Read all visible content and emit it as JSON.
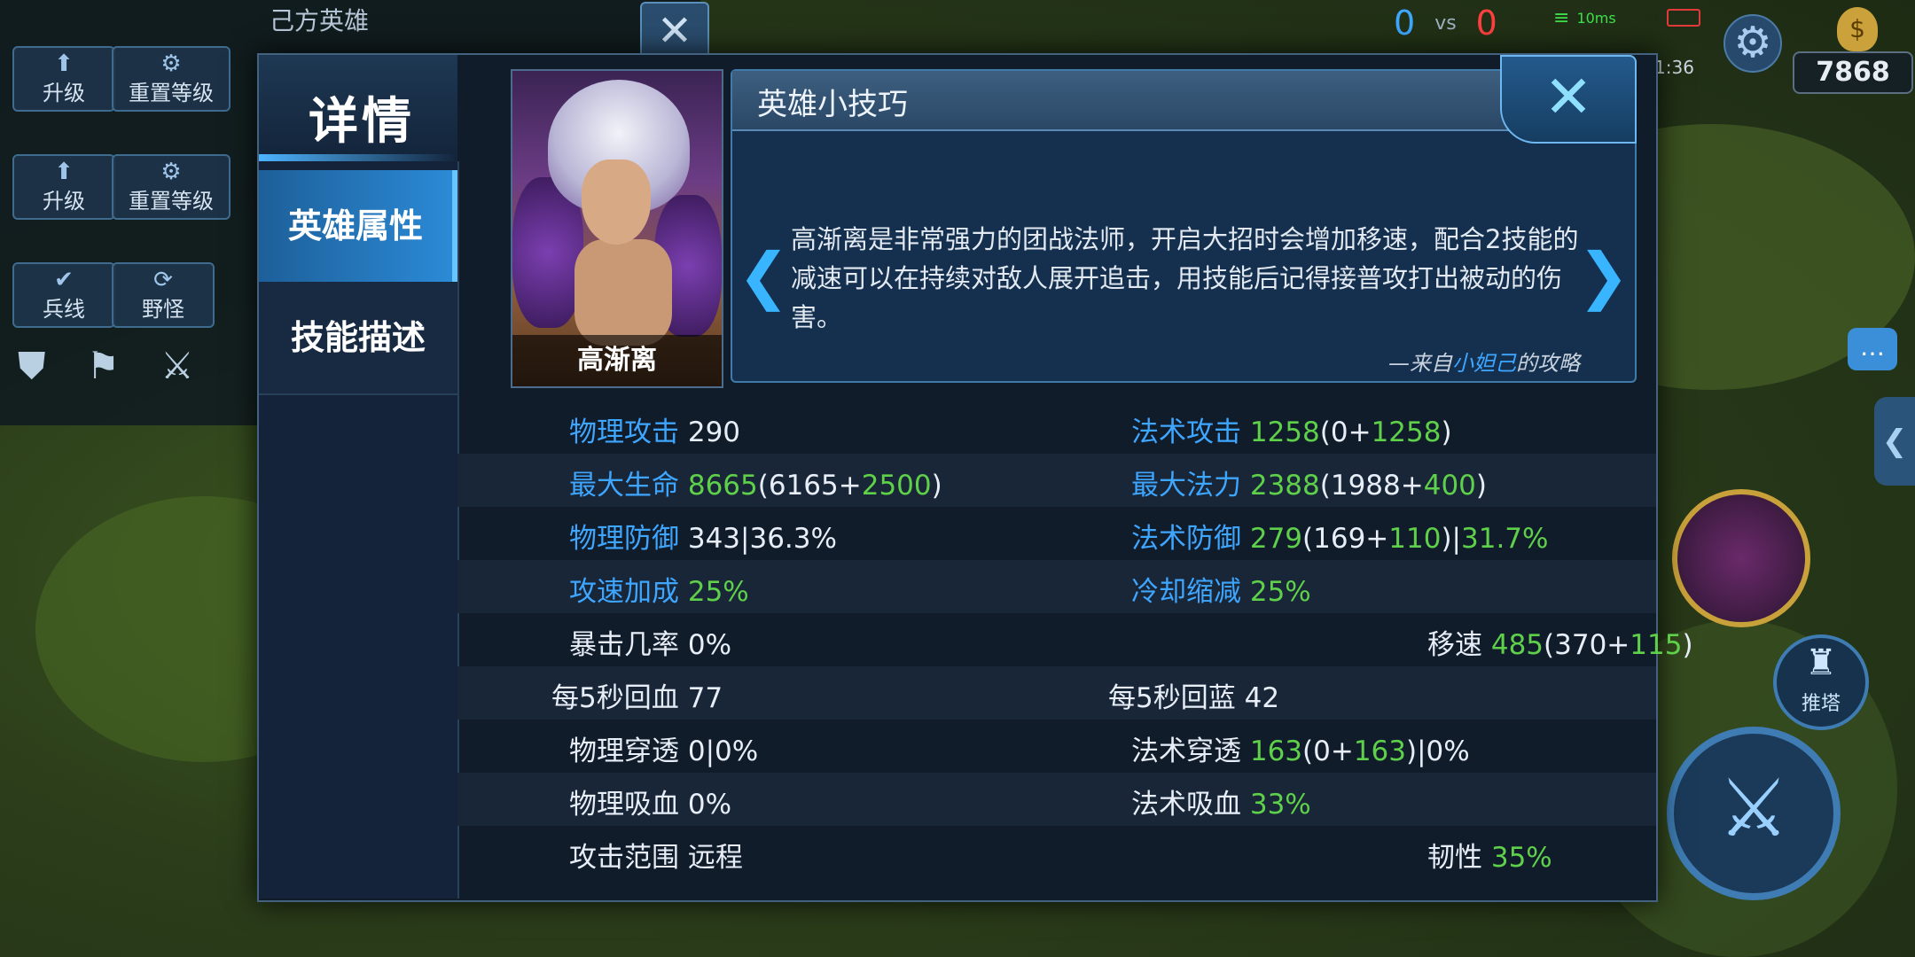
{
  "background": {
    "own_heroes_title": "己方英雄",
    "rows": [
      {
        "buttons": [
          {
            "icon": "arrow-up-icon",
            "label": "升级"
          },
          {
            "icon": "gear-icon",
            "label": "重置等级"
          }
        ]
      },
      {
        "buttons": [
          {
            "icon": "arrow-up-icon",
            "label": "升级"
          },
          {
            "icon": "gear-icon",
            "label": "重置等级"
          }
        ]
      },
      {
        "buttons": [
          {
            "icon": "check-icon",
            "label": "兵线"
          },
          {
            "icon": "refresh-icon",
            "label": "野怪"
          }
        ]
      }
    ]
  },
  "hud": {
    "score_blue": "0",
    "vs": "vs",
    "score_red": "0",
    "ping": "10ms",
    "time": "1:36",
    "gold": "7868",
    "push_tower": "推塔"
  },
  "dialog": {
    "title": "详情",
    "tabs": [
      {
        "label": "英雄属性",
        "active": true
      },
      {
        "label": "技能描述",
        "active": false
      }
    ],
    "hero_name": "高渐离",
    "tips": {
      "title": "英雄小技巧",
      "text": "高渐离是非常强力的团战法师，开启大招时会增加移速，配合2技能的减速可以在持续对敌人展开追击，用技能后记得接普攻打出被动的伤害。",
      "source_prefix": "—来自",
      "source_author": "小妲己",
      "source_suffix": "的攻略"
    },
    "stats": {
      "physical_attack": {
        "label": "物理攻击",
        "value": "290"
      },
      "magic_attack": {
        "label": "法术攻击",
        "value": "1258",
        "base": "(0+",
        "bonus": "1258",
        "close": ")"
      },
      "max_hp": {
        "label": "最大生命",
        "value": "8665",
        "base": "(6165+",
        "bonus": "2500",
        "close": ")"
      },
      "max_mana": {
        "label": "最大法力",
        "value": "2388",
        "base": "(1988+",
        "bonus": "400",
        "close": ")"
      },
      "physical_defense": {
        "label": "物理防御",
        "value": "343|36.3%"
      },
      "magic_defense": {
        "label": "法术防御",
        "value": "279",
        "base": "(169+",
        "bonus": "110",
        "close": ")|",
        "pct": "31.7%"
      },
      "attack_speed": {
        "label": "攻速加成",
        "value": "25%"
      },
      "cooldown": {
        "label": "冷却缩减",
        "value": "25%"
      },
      "crit_rate": {
        "label": "暴击几率",
        "value": "0%"
      },
      "move_speed": {
        "label": "移速",
        "value": "485",
        "base": "(370+",
        "bonus": "115",
        "close": ")"
      },
      "hp_regen": {
        "label": "每5秒回血",
        "value": "77"
      },
      "mana_regen": {
        "label": "每5秒回蓝",
        "value": "42"
      },
      "physical_pen": {
        "label": "物理穿透",
        "value": "0|0%"
      },
      "magic_pen": {
        "label": "法术穿透",
        "value": "163",
        "base": "(0+",
        "bonus": "163",
        "close": ")|0%"
      },
      "physical_lifesteal": {
        "label": "物理吸血",
        "value": "0%"
      },
      "magic_lifesteal": {
        "label": "法术吸血",
        "value": "33%"
      },
      "attack_range": {
        "label": "攻击范围",
        "value": "远程"
      },
      "tenacity": {
        "label": "韧性",
        "value": "35%"
      }
    }
  }
}
